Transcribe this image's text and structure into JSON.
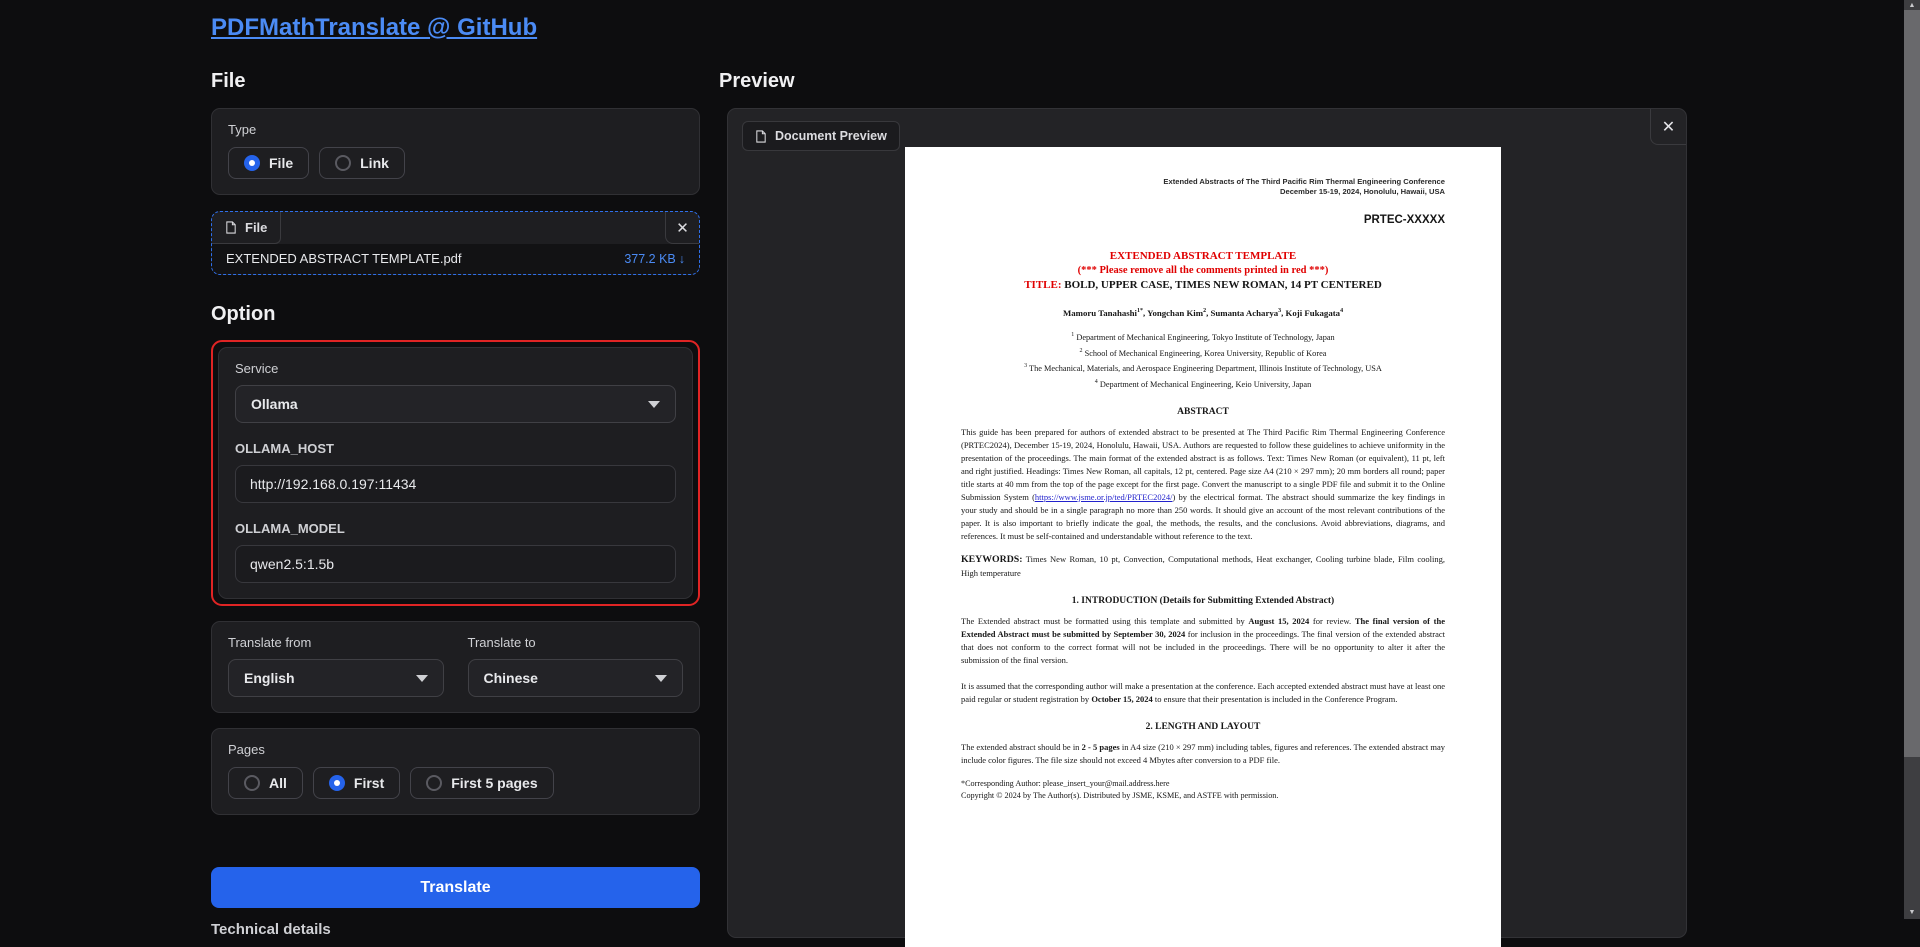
{
  "colors": {
    "accent": "#2563eb",
    "link": "#4b8bf5",
    "alert_red": "#e02424",
    "pdf_red": "#e00000",
    "background": "#0d0d0f",
    "panel": "#1e1e21"
  },
  "icons": {
    "close": "✕",
    "download": "↓",
    "scroll_up": "▲",
    "scroll_down": "▼"
  },
  "app": {
    "title_link": "PDFMathTranslate @ GitHub"
  },
  "file_section": {
    "heading": "File",
    "type_group": {
      "label": "Type",
      "options": [
        {
          "label": "File",
          "selected": true
        },
        {
          "label": "Link",
          "selected": false
        }
      ]
    },
    "file_card": {
      "tab_label": "File",
      "filename": "EXTENDED ABSTRACT TEMPLATE.pdf",
      "size": "377.2 KB"
    }
  },
  "option_section": {
    "heading": "Option",
    "service": {
      "label": "Service",
      "value": "Ollama"
    },
    "ollama_host": {
      "label": "OLLAMA_HOST",
      "value": "http://192.168.0.197:11434"
    },
    "ollama_model": {
      "label": "OLLAMA_MODEL",
      "value": "qwen2.5:1.5b"
    },
    "translate_from": {
      "label": "Translate from",
      "value": "English"
    },
    "translate_to": {
      "label": "Translate to",
      "value": "Chinese"
    },
    "pages": {
      "label": "Pages",
      "options": [
        {
          "label": "All",
          "selected": false
        },
        {
          "label": "First",
          "selected": true
        },
        {
          "label": "First 5 pages",
          "selected": false
        }
      ]
    },
    "translate_button": "Translate",
    "technical_details": "Technical details"
  },
  "preview": {
    "heading": "Preview",
    "tab_label": "Document Preview",
    "document": {
      "header_line1": "Extended Abstracts of The Third Pacific Rim Thermal Engineering Conference",
      "header_line2": "December 15-19, 2024, Honolulu, Hawaii, USA",
      "paper_no": "PRTEC-XXXXX",
      "title_red1": "EXTENDED ABSTRACT TEMPLATE",
      "title_red2": "(*** Please remove all the comments printed in red ***)",
      "title_prefix": "TITLE:",
      "title_rest": " BOLD, UPPER CASE, TIMES NEW ROMAN, 14 PT CENTERED",
      "authors": [
        {
          "name": "Mamoru Tanahashi",
          "sup": "1*"
        },
        {
          "name": ", Yongchan Kim",
          "sup": "2"
        },
        {
          "name": ", Sumanta Acharya",
          "sup": "3"
        },
        {
          "name": ", Koji Fukagata",
          "sup": "4"
        }
      ],
      "affiliations": [
        {
          "sup": "1",
          "text": " Department of Mechanical Engineering, Tokyo Institute of Technology, Japan"
        },
        {
          "sup": "2",
          "text": " School of Mechanical Engineering, Korea University, Republic of Korea"
        },
        {
          "sup": "3",
          "text": " The Mechanical, Materials, and Aerospace Engineering Department, Illinois Institute of Technology, USA"
        },
        {
          "sup": "4",
          "text": " Department of Mechanical Engineering, Keio University, Japan"
        }
      ],
      "abstract_heading": "ABSTRACT",
      "abstract": {
        "pre_link": "This guide has been prepared for authors of extended abstract to be presented at The Third Pacific Rim Thermal Engineering Conference (PRTEC2024), December 15-19, 2024, Honolulu, Hawaii, USA. Authors are requested to follow these guidelines to achieve uniformity in the presentation of the proceedings. The main format of the extended abstract is as follows. Text: Times New Roman (or equivalent), 11 pt, left and right justified. Headings: Times New Roman, all capitals, 12 pt, centered. Page size A4 (210 × 297 mm); 20 mm borders all round; paper title starts at 40 mm from the top of the page except for the first page. Convert the manuscript to a single PDF file and submit it to the Online Submission System (",
        "link": "https://www.jsme.or.jp/ted/PRTEC2024/",
        "post_link": ") by the electrical format. The abstract should summarize the key findings in your study and should be in a single paragraph no more than 250 words. It should give an account of the most relevant contributions of the paper. It is also important to briefly indicate the goal, the methods, the results, and the conclusions. Avoid abbreviations, diagrams, and references. It must be self-contained and understandable without reference to the text."
      },
      "keywords_label": "KEYWORDS:",
      "keywords_text": " Times New Roman, 10 pt, Convection, Computational methods, Heat exchanger, Cooling turbine blade, Film cooling, High temperature",
      "section1_heading": "1. INTRODUCTION (Details for Submitting Extended Abstract)",
      "intro_p1": {
        "seg1": "The Extended abstract must be formatted using this template and submitted by ",
        "bold1": "August 15, 2024",
        "seg2": " for review. ",
        "bold2": "The final version of the Extended Abstract must be submitted by September 30, 2024",
        "seg3": " for inclusion in the proceedings. The final version of the extended abstract that does not conform to the correct format will not be included in the proceedings. There will be no opportunity to alter it after the submission of the final version."
      },
      "intro_p2": {
        "seg1": "It is assumed that the corresponding author will make a presentation at the conference. Each accepted extended abstract must have at least one paid regular or student registration by ",
        "bold1": "October 15, 2024",
        "seg2": " to ensure that their presentation is included in the Conference Program."
      },
      "section2_heading": "2. LENGTH AND LAYOUT",
      "length_p1": {
        "seg1": "The extended abstract should be in ",
        "bold1": "2 - 5 pages",
        "seg2": " in A4 size (210 × 297 mm) including tables, figures and references. The extended abstract may include color figures. The file size should not exceed 4 Mbytes after conversion to a PDF file."
      },
      "footer_author": "*Corresponding Author: please_insert_your@mail.address.here",
      "footer_copyright": "Copyright © 2024 by The Author(s). Distributed by JSME, KSME, and ASTFE with permission."
    }
  }
}
